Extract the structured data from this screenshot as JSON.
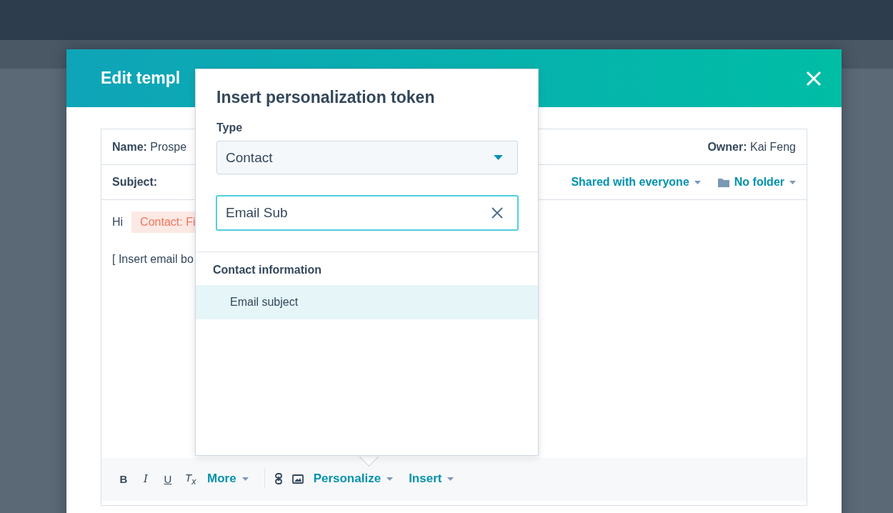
{
  "modal": {
    "title": "Edit templ"
  },
  "template": {
    "name_label": "Name:",
    "name_value": "Prospe",
    "owner_label": "Owner:",
    "owner_value": "Kai Feng",
    "subject_label": "Subject:",
    "sharing": "Shared with everyone",
    "folder": "No folder",
    "body": [
      {
        "kind": "greeting",
        "text": "Hi",
        "token": "Contact: Fi"
      },
      {
        "kind": "paragraph",
        "text": "[ Insert email bo"
      }
    ]
  },
  "toolbar": {
    "items": [
      {
        "kind": "bold",
        "text": "B"
      },
      {
        "kind": "italic",
        "text": "I"
      },
      {
        "kind": "underline",
        "text": "U"
      },
      {
        "kind": "clear",
        "text": "T$_{x}$"
      },
      {
        "kind": "menu",
        "text": "More"
      },
      {
        "kind": "separator"
      },
      {
        "kind": "link"
      },
      {
        "kind": "image"
      },
      {
        "kind": "menu",
        "text": "Personalize"
      },
      {
        "kind": "menu",
        "text": "Insert"
      }
    ]
  },
  "popover": {
    "title": "Insert personalization token",
    "type_label": "Type",
    "type_value": "Contact",
    "search_value": "Email Sub",
    "groups": [
      {
        "heading": "Contact information",
        "items": [
          {
            "label": "Email subject",
            "selected": true
          }
        ]
      }
    ]
  }
}
